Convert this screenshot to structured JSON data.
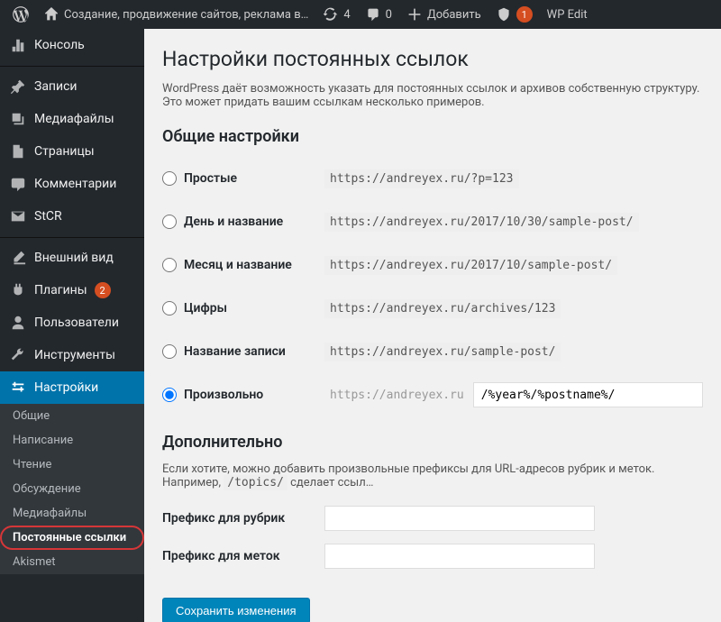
{
  "adminbar": {
    "site_title": "Создание, продвижение сайтов, реклама в…",
    "updates": "4",
    "comments": "0",
    "add_new": "Добавить",
    "notifications": "1",
    "wpedit": "WP Edit"
  },
  "sidebar": {
    "items": [
      {
        "label": "Консоль"
      },
      {
        "label": "Записи"
      },
      {
        "label": "Медиафайлы"
      },
      {
        "label": "Страницы"
      },
      {
        "label": "Комментарии"
      },
      {
        "label": "StCR"
      },
      {
        "label": "Внешний вид"
      },
      {
        "label": "Плагины",
        "badge": "2"
      },
      {
        "label": "Пользователи"
      },
      {
        "label": "Инструменты"
      },
      {
        "label": "Настройки"
      }
    ],
    "submenu": [
      "Общие",
      "Написание",
      "Чтение",
      "Обсуждение",
      "Медиафайлы",
      "Постоянные ссылки",
      "Akismet"
    ]
  },
  "page": {
    "title": "Настройки постоянных ссылок",
    "desc": "WordPress даёт возможность указать для постоянных ссылок и архивов собственную структуру. Это может придать вашим ссылкам несколько примеров.",
    "section_common": "Общие настройки",
    "options": [
      {
        "label": "Простые",
        "sample": "https://andreyex.ru/?p=123"
      },
      {
        "label": "День и название",
        "sample": "https://andreyex.ru/2017/10/30/sample-post/"
      },
      {
        "label": "Месяц и название",
        "sample": "https://andreyex.ru/2017/10/sample-post/"
      },
      {
        "label": "Цифры",
        "sample": "https://andreyex.ru/archives/123"
      },
      {
        "label": "Название записи",
        "sample": "https://andreyex.ru/sample-post/"
      }
    ],
    "custom": {
      "label": "Произвольно",
      "prefix": "https://andreyex.ru",
      "value": "/%year%/%postname%/"
    },
    "section_addl": "Дополнительно",
    "addl_desc_1": "Если хотите, можно добавить произвольные префиксы для URL-адресов рубрик и меток. Например, ",
    "addl_code": "/topics/",
    "addl_desc_2": " сделает ссыл…",
    "category_label": "Префикс для рубрик",
    "tag_label": "Префикс для меток",
    "submit": "Сохранить изменения"
  }
}
